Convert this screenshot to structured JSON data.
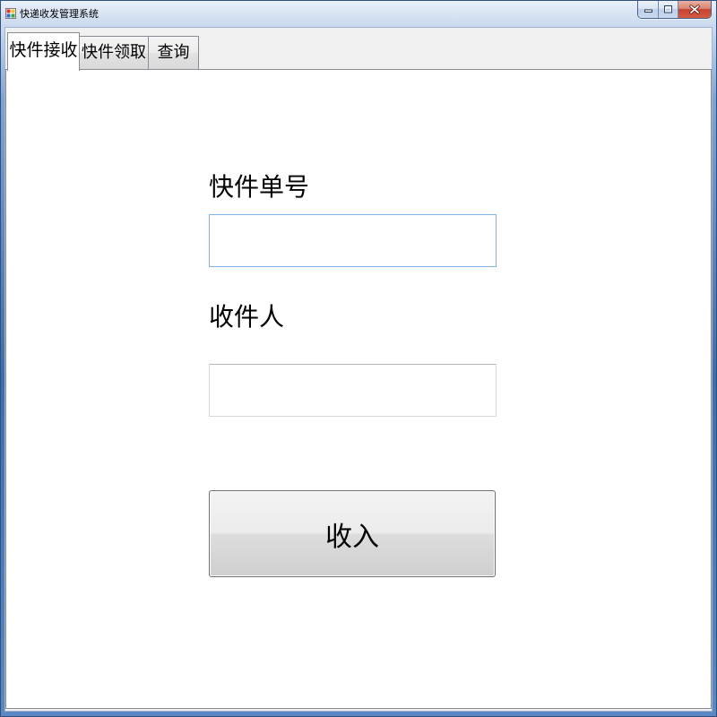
{
  "window": {
    "title": "快递收发管理系统",
    "icon": "app-icon",
    "caption_buttons": {
      "minimize_icon": "minimize-icon",
      "maximize_icon": "maximize-icon",
      "close_icon": "close-icon"
    }
  },
  "tabs": [
    {
      "label": "快件接收",
      "selected": true
    },
    {
      "label": "快件领取",
      "selected": false
    },
    {
      "label": "查询",
      "selected": false
    }
  ],
  "receive_form": {
    "tracking_number": {
      "label": "快件单号",
      "value": "",
      "focused": true
    },
    "recipient": {
      "label": "收件人",
      "value": "",
      "focused": false
    },
    "submit_button": {
      "label": "收入"
    }
  },
  "colors": {
    "focus_border": "#7eb4ea",
    "close_button": "#c7432f",
    "selected_tab": "#ffffff",
    "tab_page": "#ffffff"
  }
}
